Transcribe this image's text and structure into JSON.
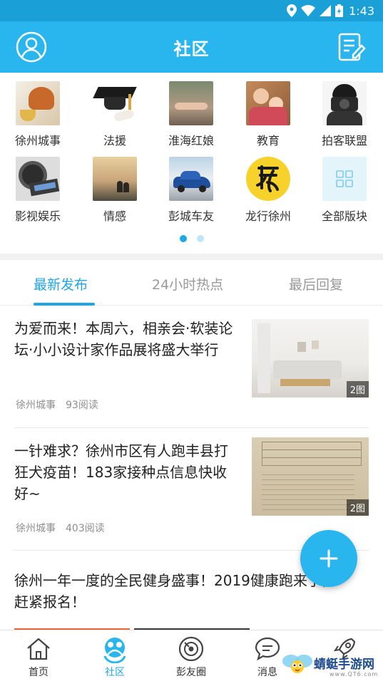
{
  "status_bar": {
    "time": "1:43"
  },
  "header": {
    "title": "社区"
  },
  "boards": [
    {
      "label": "徐州城事",
      "icon": "cake-tea-icon"
    },
    {
      "label": "法援",
      "icon": "graduation-cap-icon"
    },
    {
      "label": "淮海红娘",
      "icon": "holding-hands-icon"
    },
    {
      "label": "教育",
      "icon": "mother-child-icon"
    },
    {
      "label": "拍客联盟",
      "icon": "photographer-icon"
    },
    {
      "label": "影视娱乐",
      "icon": "film-reel-icon"
    },
    {
      "label": "情感",
      "icon": "sunset-couple-icon"
    },
    {
      "label": "彭城车友",
      "icon": "car-icon"
    },
    {
      "label": "龙行徐州",
      "icon": "dragon-calligraphy-icon"
    },
    {
      "label": "全部版块",
      "icon": "grid-icon"
    }
  ],
  "pager": {
    "pages": 2,
    "active": 1
  },
  "tabs": [
    {
      "label": "最新发布",
      "active": true
    },
    {
      "label": "24小时热点",
      "active": false
    },
    {
      "label": "最后回复",
      "active": false
    }
  ],
  "posts": [
    {
      "title": "为爱而来！本周六，相亲会·软装论坛·小小设计家作品展将盛大举行",
      "board": "徐州城事",
      "reads": "93阅读",
      "image_count": "2图"
    },
    {
      "title": "一针难求？徐州市区有人跑丰县打狂犬疫苗！183家接种点信息快收好~",
      "board": "徐州城事",
      "reads": "403阅读",
      "image_count": "2图"
    },
    {
      "title": "徐州一年一度的全民健身盛事！2019健康跑来了，赶紧报名！",
      "board": "",
      "reads": "",
      "image_count": ""
    }
  ],
  "bottom_nav": [
    {
      "label": "首页",
      "icon": "home-icon",
      "active": false
    },
    {
      "label": "社区",
      "icon": "community-icon",
      "active": true
    },
    {
      "label": "彭友圈",
      "icon": "circle-icon",
      "active": false
    },
    {
      "label": "消息",
      "icon": "message-icon",
      "active": false
    },
    {
      "label": "",
      "icon": "rocket-icon",
      "active": false
    }
  ],
  "watermark": {
    "text": "蜻蜓手游网",
    "sub": "www.QT6.com"
  },
  "colors": {
    "primary": "#29b6ee",
    "accent": "#1ea7e4",
    "status_bar": "#1a9fd6"
  }
}
